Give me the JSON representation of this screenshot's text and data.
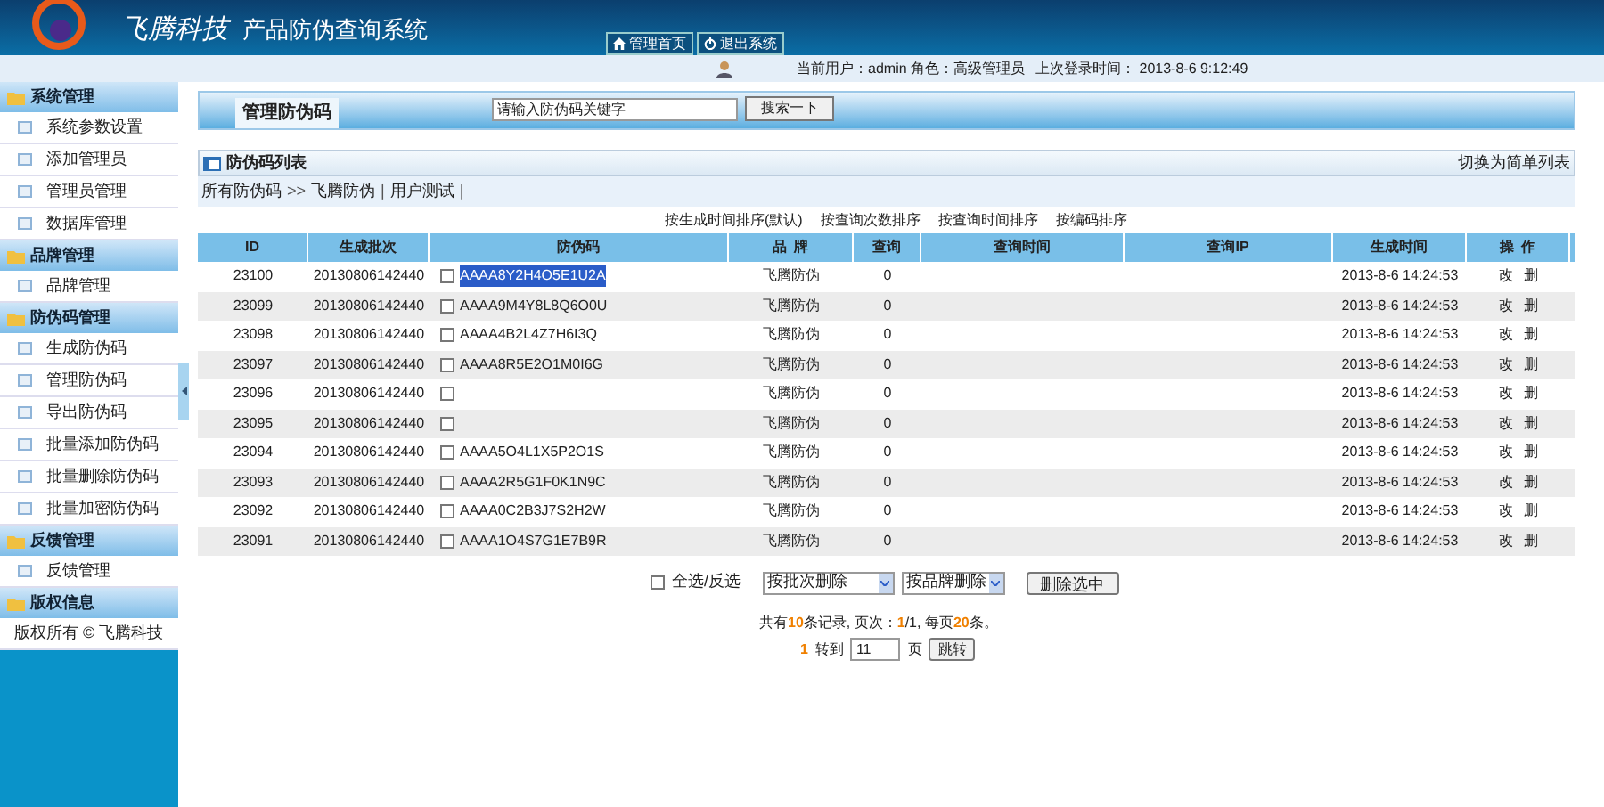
{
  "header": {
    "brand": "飞腾科技",
    "title": "产品防伪查询系统",
    "nav": [
      {
        "label": "管理首页",
        "kind": "home"
      },
      {
        "label": "退出系统",
        "kind": "power"
      }
    ]
  },
  "info_bar": {
    "user": "当前用户：admin 角色：高级管理员",
    "last_login": "上次登录时间： 2013-8-6 9:12:49"
  },
  "sidebar": [
    {
      "title": "系统管理",
      "items": [
        {
          "label": "系统参数设置"
        },
        {
          "label": "添加管理员"
        },
        {
          "label": "管理员管理"
        },
        {
          "label": "数据库管理"
        }
      ]
    },
    {
      "title": "品牌管理",
      "items": [
        {
          "label": "品牌管理"
        }
      ]
    },
    {
      "title": "防伪码管理",
      "items": [
        {
          "label": "生成防伪码"
        },
        {
          "label": "管理防伪码"
        },
        {
          "label": "导出防伪码"
        },
        {
          "label": "批量添加防伪码"
        },
        {
          "label": "批量删除防伪码"
        },
        {
          "label": "批量加密防伪码"
        }
      ]
    },
    {
      "title": "反馈管理",
      "items": [
        {
          "label": "反馈管理"
        }
      ]
    },
    {
      "title": "版权信息",
      "items": [
        {
          "label": "版权所有 © 飞腾科技",
          "kind": "text"
        }
      ]
    }
  ],
  "page_title": "管理防伪码",
  "search": {
    "value": "请输入防伪码关键字",
    "button": "搜索一下"
  },
  "list_panel": {
    "title": "防伪码列表",
    "switch_link": "切换为简单列表",
    "breadcrumb": [
      {
        "label": "所有防伪码"
      },
      {
        "label": ">>",
        "kind": "sep"
      },
      {
        "label": "飞腾防伪"
      },
      {
        "label": "|",
        "kind": "sep"
      },
      {
        "label": "用户测试"
      },
      {
        "label": "|",
        "kind": "sep"
      }
    ],
    "sort_links": [
      "按生成时间排序(默认)",
      "按查询次数排序",
      "按查询时间排序",
      "按编码排序"
    ]
  },
  "table": {
    "columns": [
      "ID",
      "生成批次",
      "防伪码",
      "品  牌",
      "查询",
      "查询时间",
      "查询IP",
      "生成时间",
      "操  作"
    ],
    "rows": [
      {
        "id": "23100",
        "batch": "20130806142440",
        "checked": false,
        "code": "AAAA8Y2H4O5E1U2A",
        "code_selected": true,
        "brand": "飞腾防伪",
        "queries": "0",
        "created": "2013-8-6 14:24:53",
        "actions": [
          "改",
          "删"
        ]
      },
      {
        "id": "23099",
        "batch": "20130806142440",
        "checked": false,
        "code": "AAAA9M4Y8L8Q6O0U",
        "code_selected": false,
        "brand": "飞腾防伪",
        "queries": "0",
        "created": "2013-8-6 14:24:53",
        "actions": [
          "改",
          "删"
        ]
      },
      {
        "id": "23098",
        "batch": "20130806142440",
        "checked": false,
        "code": "AAAA4B2L4Z7H6I3Q",
        "code_selected": false,
        "brand": "飞腾防伪",
        "queries": "0",
        "created": "2013-8-6 14:24:53",
        "actions": [
          "改",
          "删"
        ]
      },
      {
        "id": "23097",
        "batch": "20130806142440",
        "checked": false,
        "code": "AAAA8R5E2O1M0I6G",
        "code_selected": false,
        "brand": "飞腾防伪",
        "queries": "0",
        "created": "2013-8-6 14:24:53",
        "actions": [
          "改",
          "删"
        ]
      },
      {
        "id": "23096",
        "batch": "20130806142440",
        "checked": false,
        "brand": "飞腾防伪",
        "queries": "0",
        "created": "2013-8-6 14:24:53",
        "actions": [
          "改",
          "删"
        ]
      },
      {
        "id": "23095",
        "batch": "20130806142440",
        "checked": false,
        "brand": "飞腾防伪",
        "queries": "0",
        "created": "2013-8-6 14:24:53",
        "actions": [
          "改",
          "删"
        ]
      },
      {
        "id": "23094",
        "batch": "20130806142440",
        "checked": false,
        "code": "AAAA5O4L1X5P2O1S",
        "code_selected": false,
        "brand": "飞腾防伪",
        "queries": "0",
        "created": "2013-8-6 14:24:53",
        "actions": [
          "改",
          "删"
        ]
      },
      {
        "id": "23093",
        "batch": "20130806142440",
        "checked": false,
        "code": "AAAA2R5G1F0K1N9C",
        "code_selected": false,
        "brand": "飞腾防伪",
        "queries": "0",
        "created": "2013-8-6 14:24:53",
        "actions": [
          "改",
          "删"
        ]
      },
      {
        "id": "23092",
        "batch": "20130806142440",
        "checked": false,
        "code": "AAAA0C2B3J7S2H2W",
        "code_selected": false,
        "brand": "飞腾防伪",
        "queries": "0",
        "created": "2013-8-6 14:24:53",
        "actions": [
          "改",
          "删"
        ]
      },
      {
        "id": "23091",
        "batch": "20130806142440",
        "checked": false,
        "code": "AAAA1O4S7G1E7B9R",
        "code_selected": false,
        "brand": "飞腾防伪",
        "queries": "0",
        "created": "2013-8-6 14:24:53",
        "actions": [
          "改",
          "删"
        ]
      }
    ]
  },
  "bulk": {
    "select_all": {
      "label": "全选/反选",
      "checked": false
    },
    "selects": [
      "按批次删除",
      "按品牌删除"
    ],
    "button": "删除选中"
  },
  "summary": [
    {
      "text": "共有",
      "highlight": false
    },
    {
      "text": "10",
      "highlight": true
    },
    {
      "text": "条记录, 页次：",
      "highlight": false
    },
    {
      "text": "1",
      "highlight": true
    },
    {
      "text": "/1, 每页",
      "highlight": false
    },
    {
      "text": "20",
      "highlight": true
    },
    {
      "text": "条。",
      "highlight": false
    }
  ],
  "jump": {
    "page": "1",
    "label": "转到",
    "value": "11",
    "unit": "页",
    "button": "跳转"
  }
}
